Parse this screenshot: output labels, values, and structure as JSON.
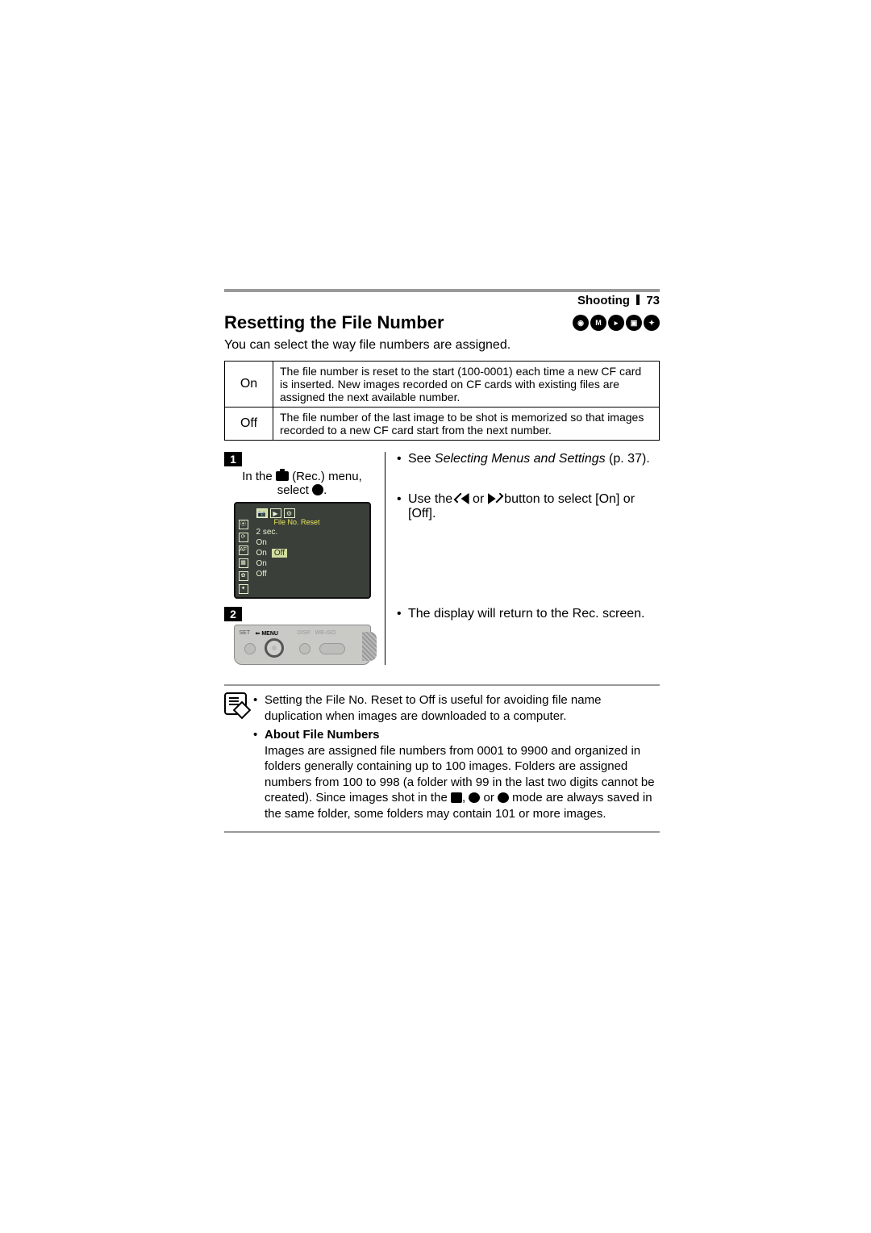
{
  "header": {
    "chapter": "Shooting",
    "page": "73"
  },
  "title": "Resetting the File Number",
  "mode_icons": [
    "camera-mode-icon",
    "m-mode-icon",
    "play-mode-icon",
    "mode-icon-2",
    "mode-icon-3"
  ],
  "intro": "You can select the way file numbers are assigned.",
  "table": {
    "on": {
      "label": "On",
      "desc": "The file number is reset to the start (100-0001) each time a new CF card is inserted. New images recorded on CF cards with existing files are assigned the next available number."
    },
    "off": {
      "label": "Off",
      "desc": "The file number of the last image to be shot is memorized so that images recorded to a new CF card start from the next number."
    }
  },
  "step1": {
    "num": "1",
    "label_a": "In the ",
    "label_b": " (Rec.) menu,",
    "label_c": "select ",
    "lcd": {
      "title": "File No. Reset",
      "rows": [
        "2 sec.",
        "On",
        "On",
        "On",
        "Off"
      ],
      "off_sel": "Off"
    },
    "right_a_pre": "See ",
    "right_a_ital": "Selecting Menus and Settings",
    "right_a_post": " (p. 37).",
    "right_b_pre": "Use the ",
    "right_b_mid": " or ",
    "right_b_post": " button to select [On] or [Off]."
  },
  "step2": {
    "num": "2",
    "cam": {
      "set": "SET",
      "menu": "MENU",
      "disp": "DISP.",
      "wb": "WB-ISO"
    },
    "right": "The display will return to the Rec. screen."
  },
  "notes": {
    "n1": "Setting the File No. Reset to Off is useful for avoiding file name duplication when images are downloaded to a computer.",
    "n2_title": "About File Numbers",
    "n2_body_a": "Images are assigned file numbers from 0001 to 9900 and organized in folders generally containing up to 100 images. Folders are assigned numbers from 100 to 998 (a folder with 99 in the last two digits cannot be created). Since images shot in the ",
    "n2_comma": ", ",
    "n2_or": " or ",
    "n2_body_b": " mode are always saved in the same folder, some folders may contain 101 or more images."
  }
}
